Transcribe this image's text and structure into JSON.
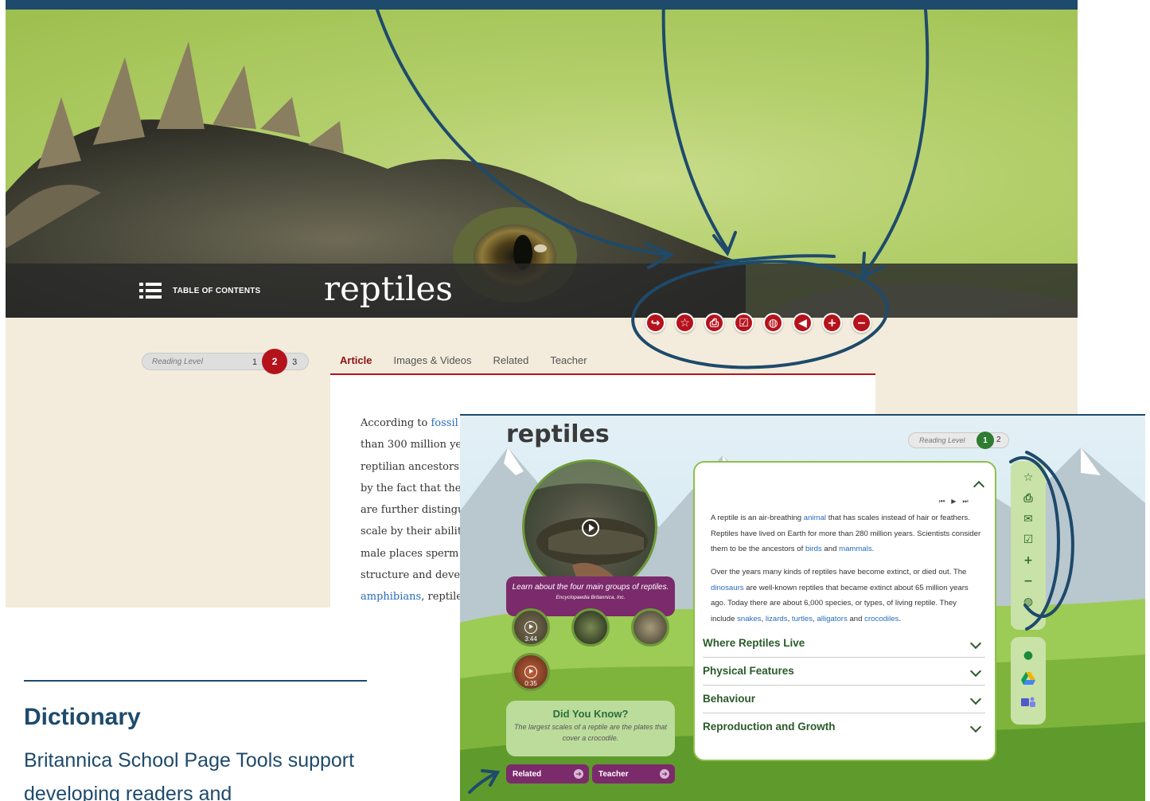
{
  "top_screenshot": {
    "toc_label": "TABLE OF CONTENTS",
    "title": "reptiles",
    "toolbar": {
      "icons": [
        "share-icon",
        "favorite-icon",
        "print-icon",
        "assignment-icon",
        "translate-icon",
        "read-aloud-icon",
        "zoom-in-icon",
        "zoom-out-icon"
      ]
    },
    "reading_level": {
      "label": "Reading Level",
      "levels": [
        "1",
        "2",
        "3"
      ],
      "active": "2"
    },
    "tabs": [
      "Article",
      "Images & Videos",
      "Related",
      "Teacher"
    ],
    "active_tab": "Article",
    "article_lines": [
      {
        "pre": "According to ",
        "link": "fossil",
        "post": ""
      },
      {
        "pre": "than 300 million ye",
        "link": "",
        "post": ""
      },
      {
        "pre": "reptilian ancestors.",
        "link": "",
        "post": ""
      },
      {
        "pre": "by the fact that they",
        "link": "",
        "post": ""
      },
      {
        "pre": "are further distingu",
        "link": "",
        "post": ""
      },
      {
        "pre": "scale by their ability",
        "link": "",
        "post": ""
      },
      {
        "pre": "male places sperm",
        "link": "",
        "post": ""
      },
      {
        "pre": "structure and devel",
        "link": "",
        "post": ""
      },
      {
        "pre": "",
        "link": "amphibians",
        "post": ", reptile"
      }
    ],
    "colors": {
      "accent": "#b5131c",
      "title_bar": "#282828",
      "body_bg": "#f3ecdc"
    }
  },
  "second_screenshot": {
    "title": "reptiles",
    "reading_level": {
      "label": "Reading Level",
      "active": "1",
      "other": "2"
    },
    "video_caption": "Learn about the four main groups of reptiles.",
    "video_credit": "Encyclopaedia Britannica, Inc.",
    "thumb_durations": [
      "3:44",
      "0:35"
    ],
    "did_you_know": {
      "title": "Did You Know?",
      "text": "The largest scales of a reptile are the plates that cover a crocodile."
    },
    "buttons": [
      "Related",
      "Teacher"
    ],
    "paragraph1": [
      {
        "t": "A reptile is an air-breathing "
      },
      {
        "l": "animal"
      },
      {
        "t": " that has scales instead of hair or feathers. Reptiles have lived on Earth for more than 280 million years. Scientists consider them to be the ancestors of "
      },
      {
        "l": "birds"
      },
      {
        "t": " and "
      },
      {
        "l": "mammals"
      },
      {
        "t": "."
      }
    ],
    "paragraph2": [
      {
        "t": "Over the years many kinds of reptiles have become extinct, or died out. The "
      },
      {
        "l": "dinosaurs"
      },
      {
        "t": " are well-known reptiles that became extinct about 65 million years ago. Today there are about 6,000 species, or types, of living reptile. They include "
      },
      {
        "l": "snakes"
      },
      {
        "t": ", "
      },
      {
        "l": "lizards"
      },
      {
        "t": ", "
      },
      {
        "l": "turtles"
      },
      {
        "t": ", "
      },
      {
        "l": "alligators"
      },
      {
        "t": " and "
      },
      {
        "l": "crocodiles"
      },
      {
        "t": "."
      }
    ],
    "sections": [
      "Where Reptiles Live",
      "Physical Features",
      "Behaviour",
      "Reproduction and Growth"
    ],
    "rail_tools": [
      "star-icon",
      "print-icon",
      "email-icon",
      "assignment-icon",
      "zoom-in-icon",
      "zoom-out-icon",
      "translate-icon"
    ],
    "share_tools": [
      "google-classroom-icon",
      "google-drive-icon",
      "microsoft-teams-icon"
    ],
    "colors": {
      "accent_green": "#2e7d32",
      "purple": "#7b2a6b",
      "panel_green": "#c9e2a7"
    }
  },
  "caption": {
    "heading": "Dictionary",
    "body": "Britannica School Page Tools support developing readers and"
  }
}
